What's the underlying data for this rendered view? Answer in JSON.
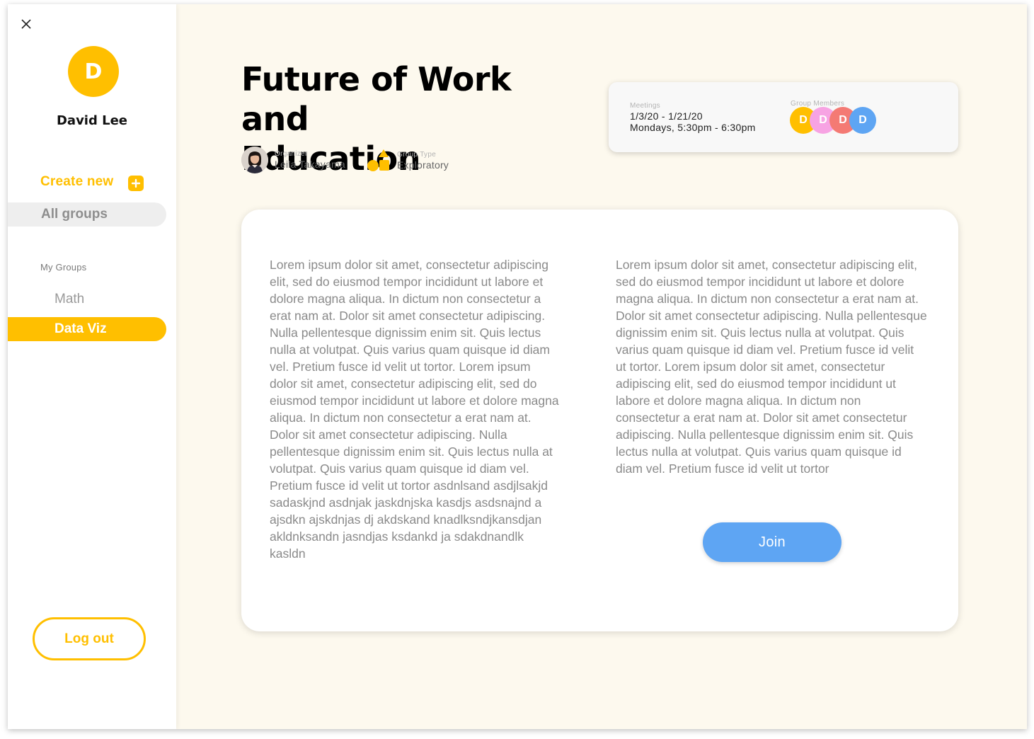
{
  "sidebar": {
    "avatar_initial": "D",
    "user_name": "David Lee",
    "create_new_label": "Create new",
    "all_groups_label": "All groups",
    "my_groups_title": "My Groups",
    "groups": [
      "Math",
      "Data Viz"
    ],
    "active_group": "Data Viz",
    "logout_label": "Log out"
  },
  "group": {
    "title_line1": "Future of Work and",
    "title_line2": "Education",
    "organizer_label": "Organizer",
    "organizer_name": "Leila Takayama",
    "type_label": "Group Type",
    "type_value": "Exploratory"
  },
  "info": {
    "meetings_label": "Meetings",
    "date_range": "1/3/20 - 1/21/20",
    "schedule": "Mondays, 5:30pm - 6:30pm",
    "members_label": "Group Members",
    "members": [
      {
        "initial": "D",
        "color": "#ffbf00"
      },
      {
        "initial": "D",
        "color": "#f7a3e3"
      },
      {
        "initial": "D",
        "color": "#f47a74"
      },
      {
        "initial": "D",
        "color": "#5ea5f3"
      }
    ]
  },
  "description": {
    "left": "Lorem ipsum dolor sit amet, consectetur adipiscing elit, sed do eiusmod tempor incididunt ut labore et dolore magna aliqua. In dictum non consectetur a erat nam at. Dolor sit amet consectetur adipiscing. Nulla pellentesque dignissim enim sit. Quis lectus nulla at volutpat. Quis varius quam quisque id diam vel. Pretium fusce id velit ut tortor. Lorem ipsum dolor sit amet, consectetur adipiscing elit, sed do eiusmod tempor incididunt ut labore et dolore magna aliqua. In dictum non consectetur a erat nam at. Dolor sit amet consectetur adipiscing. Nulla pellentesque dignissim enim sit. Quis lectus nulla at volutpat. Quis varius quam quisque id diam vel. Pretium fusce id velit ut tortor asdnlsand asdjlsakjd sadaskjnd asdnjak jaskdnjska kasdjs asdsnajnd a ajsdkn ajskdnjas dj akdskand knadlksndjkansdjan akldnksandn jasndjas  ksdankd ja sdakdnandlk kasldn",
    "right": "Lorem ipsum dolor sit amet, consectetur adipiscing elit, sed do eiusmod tempor incididunt ut labore et dolore magna aliqua. In dictum non consectetur a erat nam at. Dolor sit amet consectetur adipiscing. Nulla pellentesque dignissim enim sit. Quis lectus nulla at volutpat. Quis varius quam quisque id diam vel. Pretium fusce id velit ut tortor. Lorem ipsum dolor sit amet, consectetur adipiscing elit, sed do eiusmod tempor incididunt ut labore et dolore magna aliqua. In dictum non consectetur a erat nam at. Dolor sit amet consectetur adipiscing. Nulla pellentesque dignissim enim sit. Quis lectus nulla at volutpat. Quis varius quam quisque id diam vel. Pretium fusce id velit ut tortor"
  },
  "join_label": "Join",
  "colors": {
    "accent": "#ffbf00",
    "join": "#5ea5f3",
    "background": "#fdf9ee"
  }
}
